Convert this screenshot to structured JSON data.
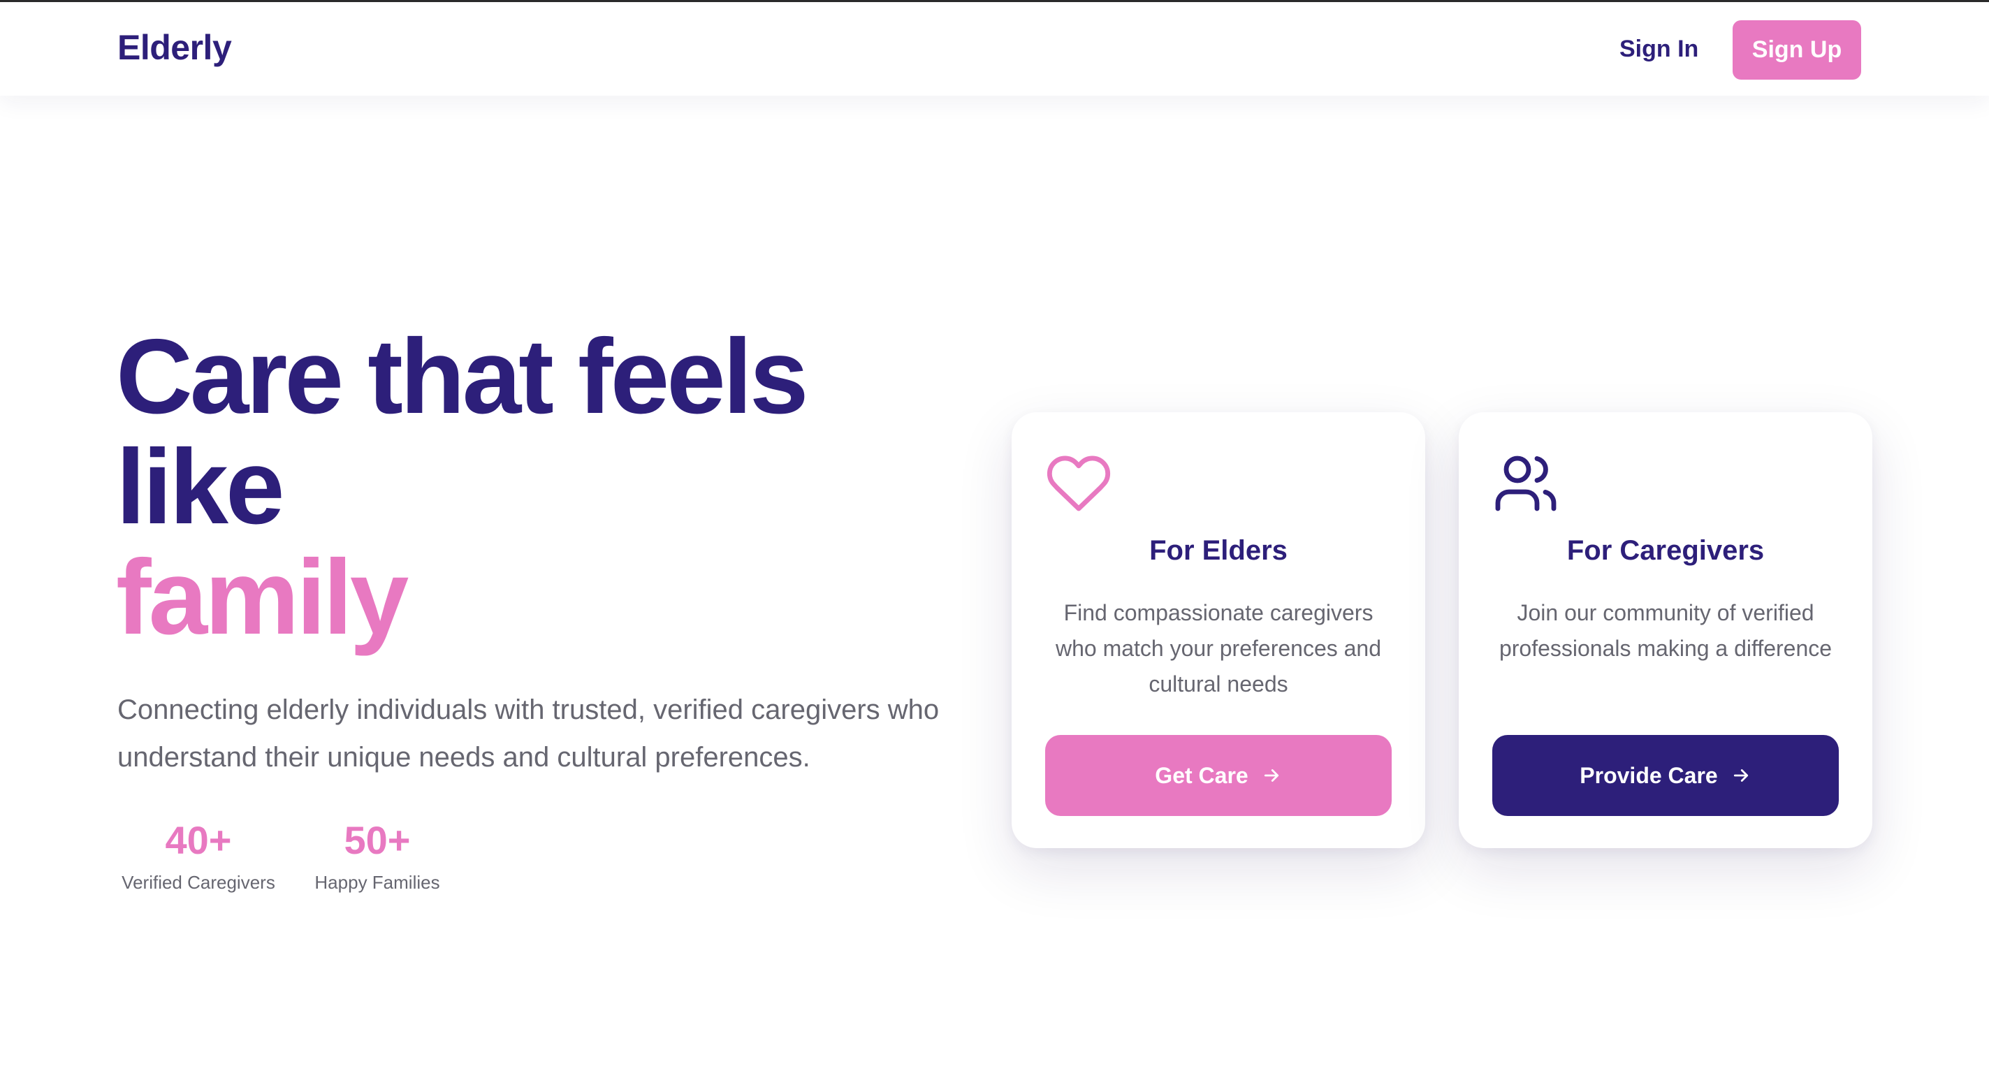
{
  "header": {
    "logo": "Elderly",
    "sign_in_label": "Sign In",
    "sign_up_label": "Sign Up"
  },
  "hero": {
    "title_line_1": "Care that feels",
    "title_line_2": "like",
    "title_accent": "family",
    "subtitle": "Connecting elderly individuals with trusted, verified caregivers who understand their unique needs and cultural preferences.",
    "stats": [
      {
        "value": "40+",
        "label": "Verified Caregivers"
      },
      {
        "value": "50+",
        "label": "Happy Families"
      }
    ]
  },
  "cards": [
    {
      "icon": "heart-icon",
      "title": "For Elders",
      "description": "Find compassionate caregivers who match your preferences and cultural needs",
      "button_label": "Get Care"
    },
    {
      "icon": "users-icon",
      "title": "For Caregivers",
      "description": "Join our community of verified professionals making a difference",
      "button_label": "Provide Care"
    }
  ],
  "colors": {
    "brand_navy": "#2d1f7a",
    "brand_pink": "#e879c1",
    "muted_text": "#666670"
  }
}
